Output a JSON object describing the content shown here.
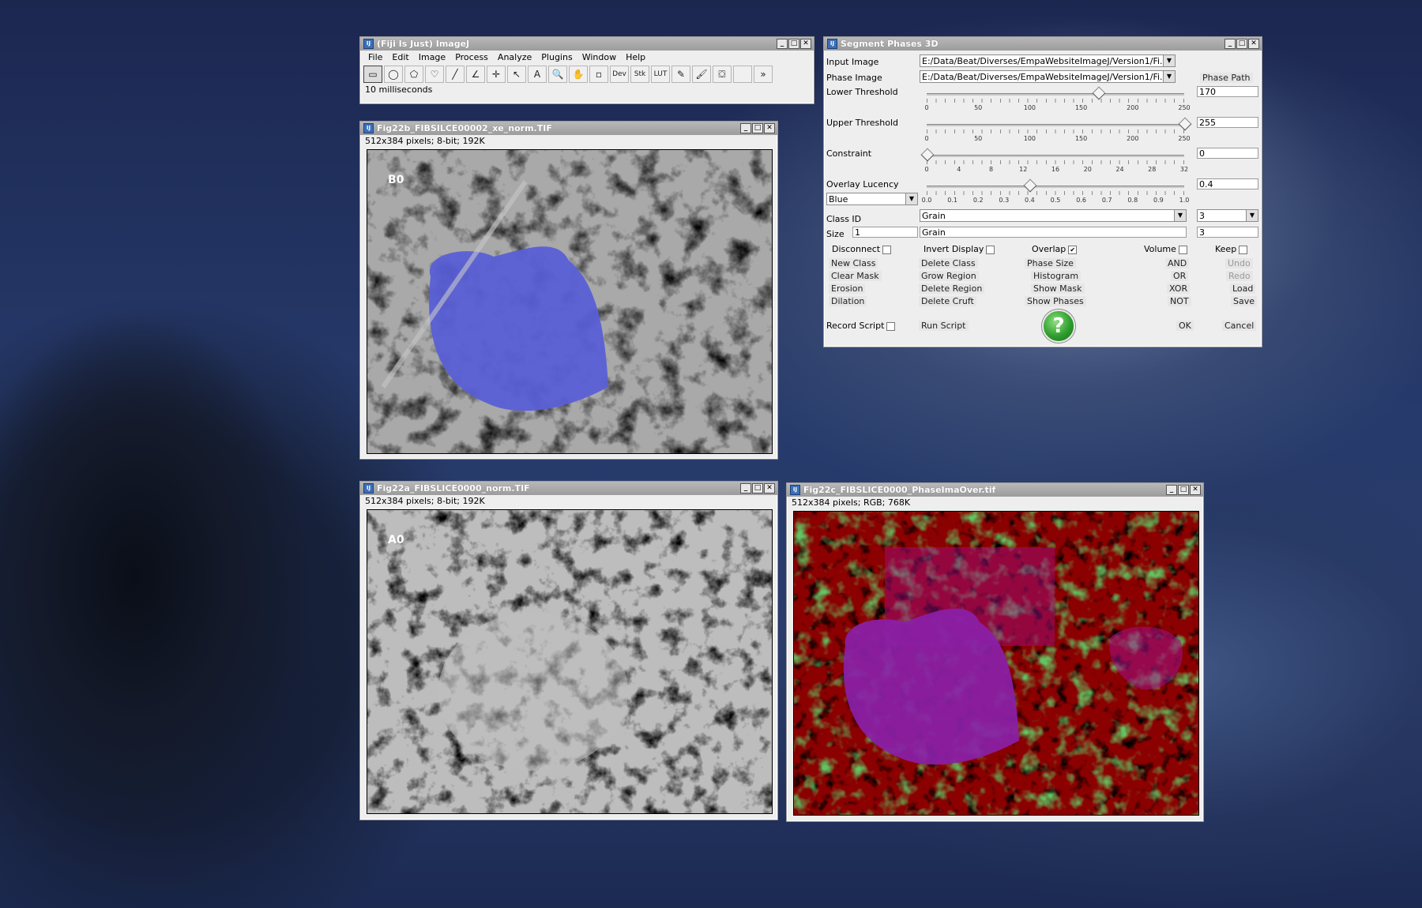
{
  "desktop": {
    "background": "dark blue mountain photo"
  },
  "imagej": {
    "title": "(Fiji Is Just) ImageJ",
    "menus": [
      "File",
      "Edit",
      "Image",
      "Process",
      "Analyze",
      "Plugins",
      "Window",
      "Help"
    ],
    "tools": [
      {
        "icon": "rectangle-tool-icon",
        "glyph": "▭"
      },
      {
        "icon": "oval-tool-icon",
        "glyph": "◯"
      },
      {
        "icon": "polygon-tool-icon",
        "glyph": "⬠"
      },
      {
        "icon": "freehand-tool-icon",
        "glyph": "♡"
      },
      {
        "icon": "line-tool-icon",
        "glyph": "╱"
      },
      {
        "icon": "angle-tool-icon",
        "glyph": "∠"
      },
      {
        "icon": "point-tool-icon",
        "glyph": "✛"
      },
      {
        "icon": "wand-tool-icon",
        "glyph": "↖"
      },
      {
        "icon": "text-tool-icon",
        "glyph": "A"
      },
      {
        "icon": "magnifier-tool-icon",
        "glyph": "🔍"
      },
      {
        "icon": "hand-tool-icon",
        "glyph": "✋"
      },
      {
        "icon": "dropper-tool-icon",
        "glyph": "▫"
      },
      {
        "icon": "dev-tool-icon",
        "glyph": "Dev"
      },
      {
        "icon": "stk-tool-icon",
        "glyph": "Stk"
      },
      {
        "icon": "lut-tool-icon",
        "glyph": "LUT"
      },
      {
        "icon": "pencil-tool-icon",
        "glyph": "✎"
      },
      {
        "icon": "brush-tool-icon",
        "glyph": "🖌"
      },
      {
        "icon": "flood-fill-tool-icon",
        "glyph": "⛋"
      },
      {
        "icon": "blank-tool-icon",
        "glyph": ""
      },
      {
        "icon": "more-tools-icon",
        "glyph": "»"
      }
    ],
    "status": "10 milliseconds"
  },
  "win_b": {
    "title": "Fig22b_FIBSILCE00002_xe_norm.TIF",
    "info": "512x384 pixels; 8-bit; 192K",
    "label": "B0"
  },
  "win_a": {
    "title": "Fig22a_FIBSLICE0000_norm.TIF",
    "info": "512x384 pixels; 8-bit; 192K",
    "label": "A0"
  },
  "win_c": {
    "title": "Fig22c_FIBSLICE0000_PhaseImaOver.tif",
    "info": "512x384 pixels; RGB; 768K"
  },
  "segment": {
    "title": "Segment Phases 3D",
    "input_image_label": "Input Image",
    "input_image_value": "E:/Data/Beat/Diverses/EmpaWebsiteImageJ/Version1/Fi...",
    "phase_image_label": "Phase Image",
    "phase_image_value": "E:/Data/Beat/Diverses/EmpaWebsiteImageJ/Version1/Fi...",
    "phase_path_button": "Phase Path",
    "lower_threshold_label": "Lower Threshold",
    "lower_threshold_value": "170",
    "lower_threshold_level": 170,
    "upper_threshold_label": "Upper Threshold",
    "upper_threshold_value": "255",
    "upper_threshold_level": 255,
    "threshold_ticks": [
      "0",
      "50",
      "100",
      "150",
      "200",
      "250"
    ],
    "constraint_label": "Constraint",
    "constraint_value": "0",
    "constraint_level": 0,
    "constraint_ticks": [
      "0",
      "4",
      "8",
      "12",
      "16",
      "20",
      "24",
      "28",
      "32"
    ],
    "overlay_lucency_label": "Overlay Lucency",
    "overlay_lucency_value": "0.4",
    "overlay_lucency_level": 0.4,
    "lucency_ticks": [
      "0.0",
      "0.1",
      "0.2",
      "0.3",
      "0.4",
      "0.5",
      "0.6",
      "0.7",
      "0.8",
      "0.9",
      "1.0"
    ],
    "color_value": "Blue",
    "class_id_label": "Class ID",
    "class_id_value": "1",
    "class_name_combo": "Grain",
    "class_count_combo": "3",
    "size_label": "Size",
    "size_value": "1",
    "class_name_field": "Grain",
    "class_count_field": "3",
    "checkboxes": {
      "disconnect": "Disconnect",
      "invert_display": "Invert Display",
      "overlap": "Overlap",
      "overlap_checked": "✔",
      "volume": "Volume",
      "keep": "Keep"
    },
    "buttons": {
      "new_class": "New Class",
      "delete_class": "Delete Class",
      "phase_size": "Phase Size",
      "and": "AND",
      "undo": "Undo",
      "clear_mask": "Clear Mask",
      "grow_region": "Grow Region",
      "histogram": "Histogram",
      "or": "OR",
      "redo": "Redo",
      "erosion": "Erosion",
      "delete_region": "Delete Region",
      "show_mask": "Show Mask",
      "xor": "XOR",
      "load": "Load",
      "dilation": "Dilation",
      "delete_cruft": "Delete Cruft",
      "show_phases": "Show Phases",
      "not": "NOT",
      "save": "Save",
      "record_script": "Record Script",
      "run_script": "Run Script",
      "help": "?",
      "ok": "OK",
      "cancel": "Cancel"
    }
  },
  "window_controls": {
    "minimize": "_",
    "maximize": "□",
    "close": "✕"
  },
  "colors": {
    "overlay_blue": "#5a5fd6",
    "phase_red": "#8b0000",
    "phase_green": "#1e8c1e",
    "phase_purple": "#8a1fa8"
  }
}
